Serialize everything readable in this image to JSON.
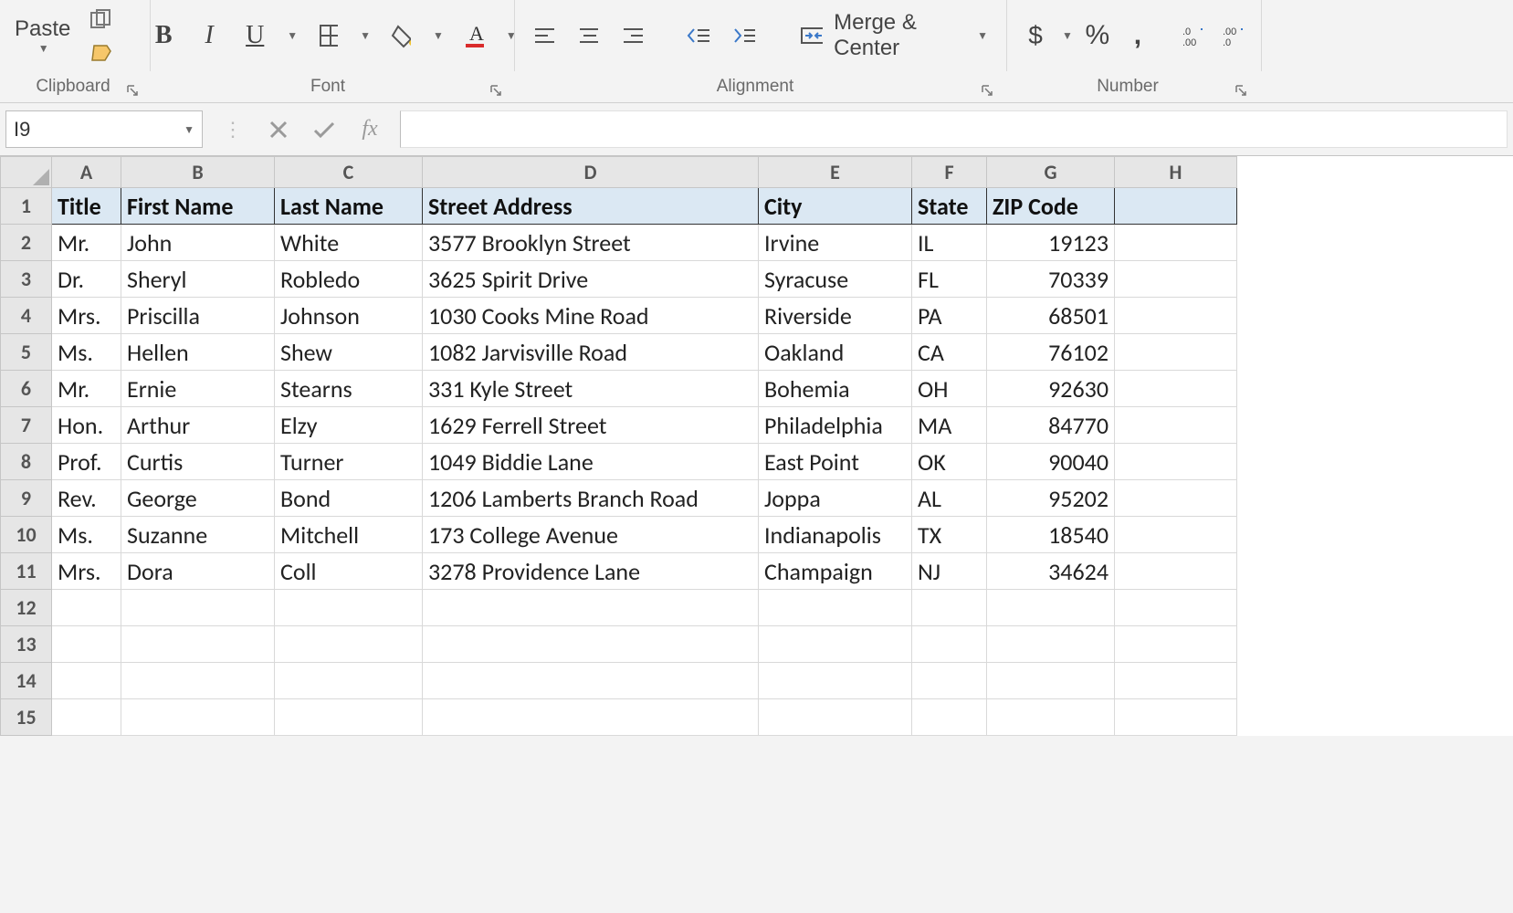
{
  "ribbon": {
    "paste_label": "Paste",
    "merge_label": "Merge & Center",
    "group_clipboard": "Clipboard",
    "group_font": "Font",
    "group_alignment": "Alignment",
    "group_number": "Number",
    "bold": "B",
    "italic": "I",
    "underline": "U",
    "currency": "$",
    "percent": "%",
    "thousands": ","
  },
  "formula_bar": {
    "name_box": "I9",
    "fx": "fx",
    "value": ""
  },
  "sheet": {
    "columns": [
      "A",
      "B",
      "C",
      "D",
      "E",
      "F",
      "G",
      "H"
    ],
    "row_count_visible": 15,
    "headers": [
      "Title",
      "First Name",
      "Last Name",
      "Street Address",
      "City",
      "State",
      "ZIP Code"
    ],
    "rows": [
      {
        "title": "Mr.",
        "first": "John",
        "last": "White",
        "street": "3577 Brooklyn Street",
        "city": "Irvine",
        "state": "IL",
        "zip": "19123"
      },
      {
        "title": "Dr.",
        "first": "Sheryl",
        "last": "Robledo",
        "street": "3625 Spirit Drive",
        "city": "Syracuse",
        "state": "FL",
        "zip": "70339"
      },
      {
        "title": "Mrs.",
        "first": "Priscilla",
        "last": "Johnson",
        "street": "1030 Cooks Mine Road",
        "city": "Riverside",
        "state": "PA",
        "zip": "68501"
      },
      {
        "title": "Ms.",
        "first": "Hellen",
        "last": "Shew",
        "street": "1082 Jarvisville Road",
        "city": "Oakland",
        "state": "CA",
        "zip": "76102"
      },
      {
        "title": "Mr.",
        "first": "Ernie",
        "last": "Stearns",
        "street": "331 Kyle Street",
        "city": "Bohemia",
        "state": "OH",
        "zip": "92630"
      },
      {
        "title": "Hon.",
        "first": "Arthur",
        "last": "Elzy",
        "street": "1629 Ferrell Street",
        "city": "Philadelphia",
        "state": "MA",
        "zip": "84770"
      },
      {
        "title": "Prof.",
        "first": "Curtis",
        "last": "Turner",
        "street": "1049 Biddie Lane",
        "city": "East Point",
        "state": "OK",
        "zip": "90040"
      },
      {
        "title": "Rev.",
        "first": "George",
        "last": "Bond",
        "street": "1206 Lamberts Branch Road",
        "city": "Joppa",
        "state": "AL",
        "zip": "95202"
      },
      {
        "title": "Ms.",
        "first": "Suzanne",
        "last": "Mitchell",
        "street": "173 College Avenue",
        "city": "Indianapolis",
        "state": "TX",
        "zip": "18540"
      },
      {
        "title": "Mrs.",
        "first": "Dora",
        "last": "Coll",
        "street": "3278 Providence Lane",
        "city": "Champaign",
        "state": "NJ",
        "zip": "34624"
      }
    ]
  }
}
